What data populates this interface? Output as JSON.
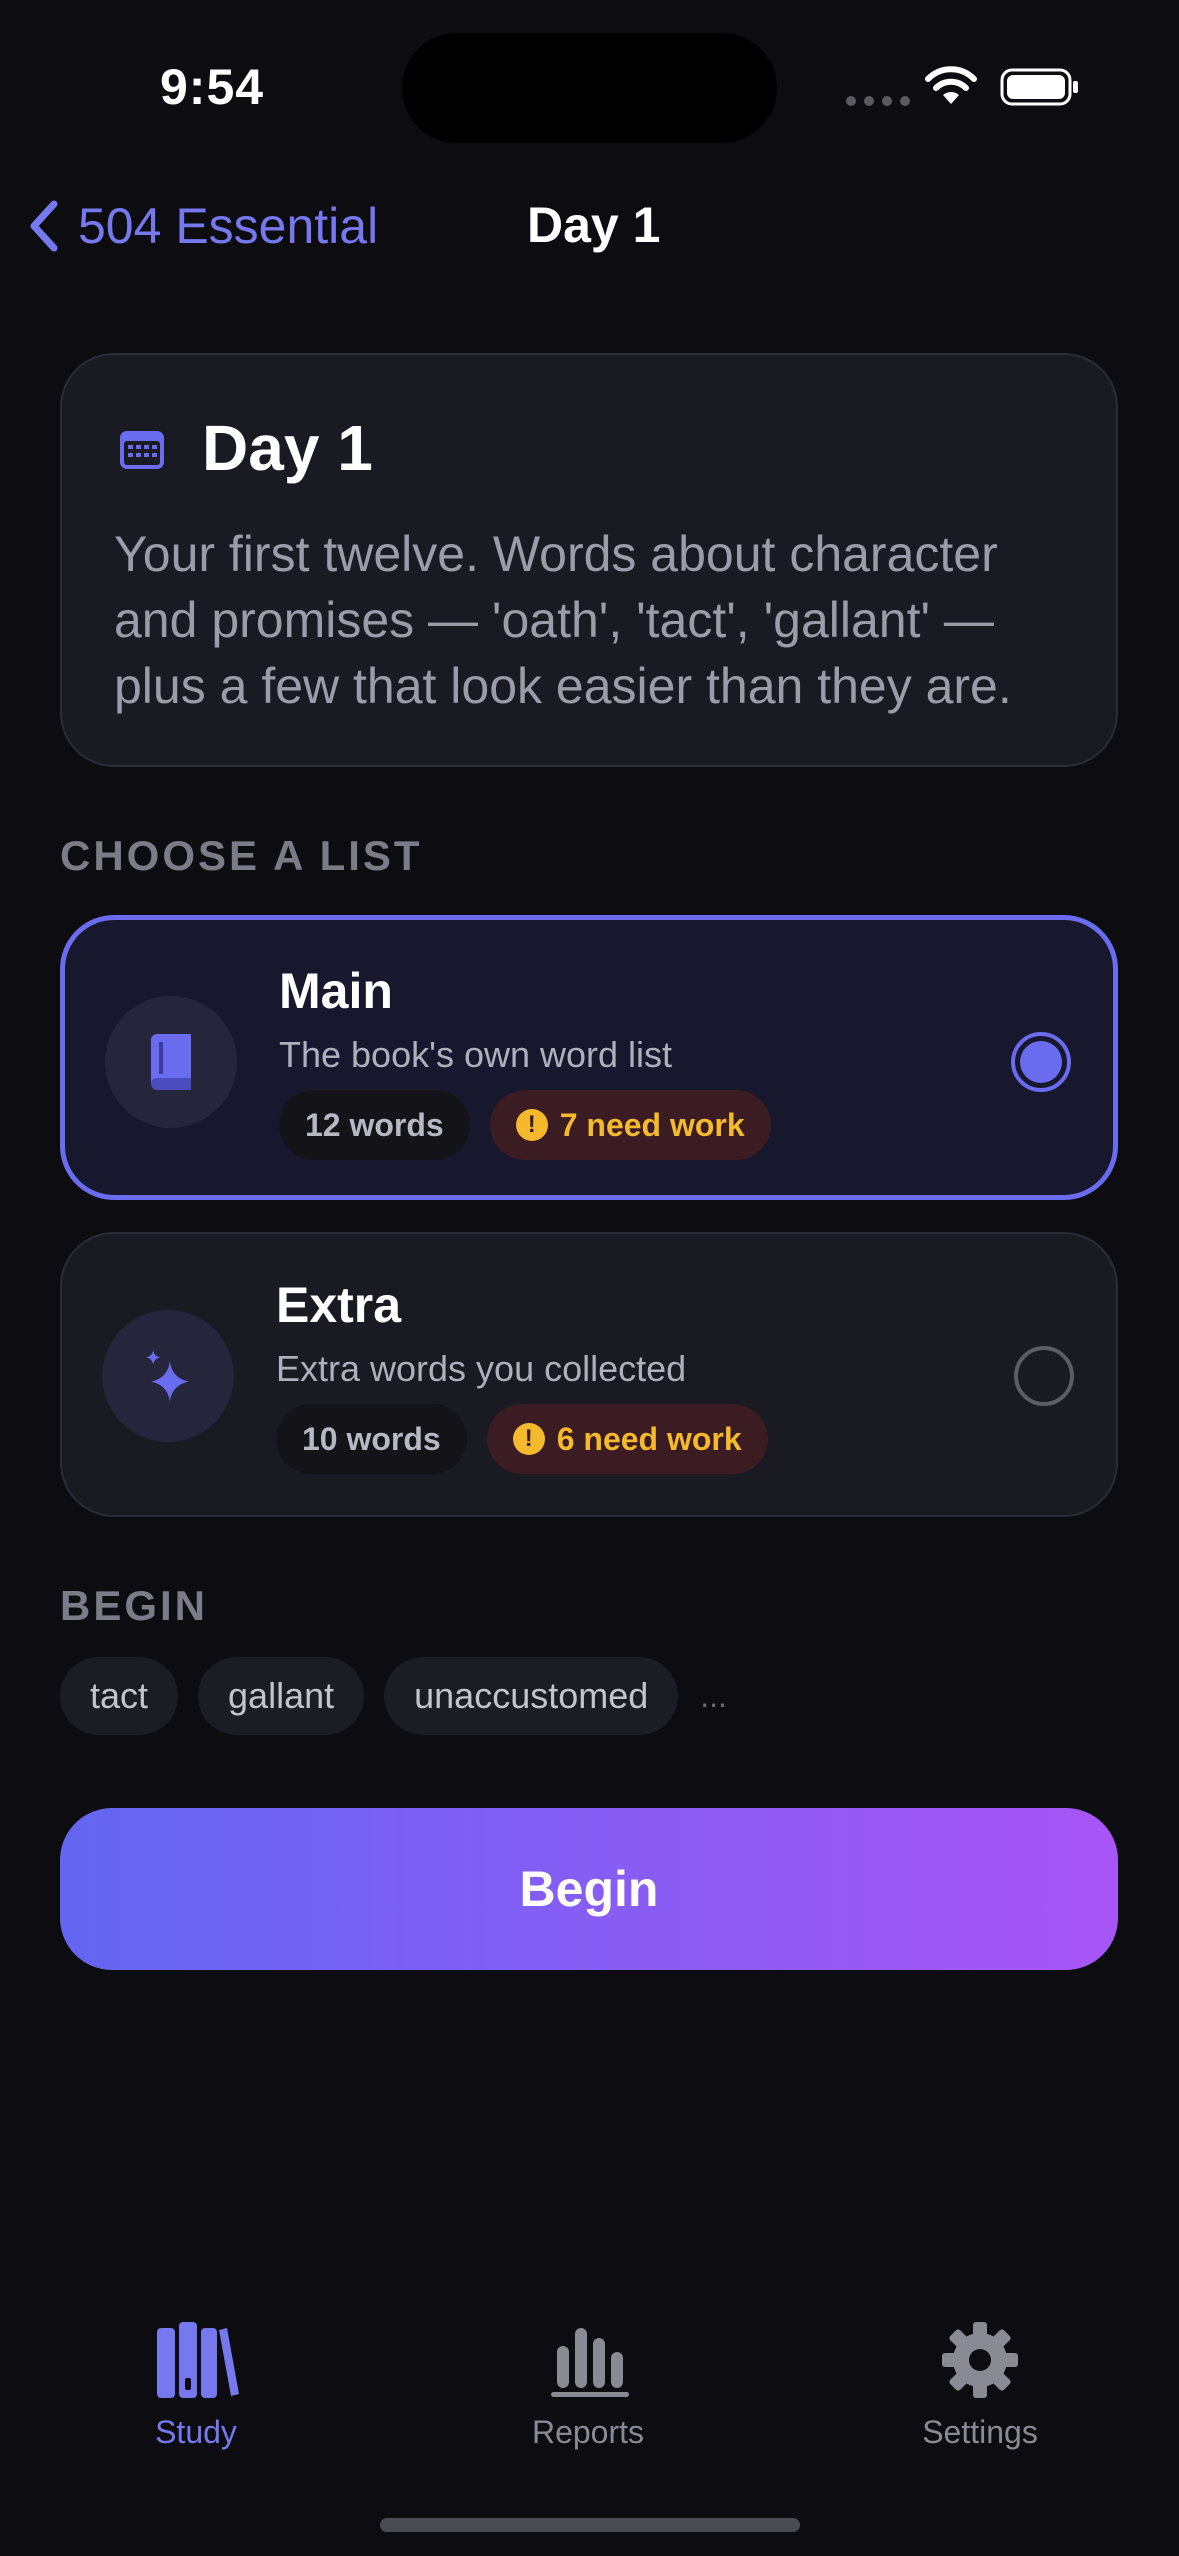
{
  "status": {
    "time": "9:54"
  },
  "nav": {
    "back_label": "504 Essential",
    "title": "Day 1"
  },
  "day_card": {
    "icon": "calendar-icon",
    "heading": "Day 1",
    "description": "Your first twelve. Words about character and promises — 'oath', 'tact', 'gallant' — plus a few that look easier than they are."
  },
  "choose_label": "CHOOSE A LIST",
  "lists": [
    {
      "icon": "book-icon",
      "title": "Main",
      "subtitle": "The book's own word list",
      "count": "12 words",
      "need_work": "7 need work",
      "selected": true
    },
    {
      "icon": "sparkles-icon",
      "title": "Extra",
      "subtitle": "Extra words you collected",
      "count": "10 words",
      "need_work": "6 need work",
      "selected": false
    }
  ],
  "begin_label": "BEGIN",
  "preview_words": [
    "tact",
    "gallant",
    "unaccustomed"
  ],
  "preview_more": "...",
  "begin_button": "Begin",
  "tabs": [
    {
      "label": "Study",
      "icon": "books-icon",
      "active": true
    },
    {
      "label": "Reports",
      "icon": "bar-chart-icon",
      "active": false
    },
    {
      "label": "Settings",
      "icon": "gear-icon",
      "active": false
    }
  ],
  "colors": {
    "accent": "#6a6cf0",
    "gradient_start": "#6366f1",
    "gradient_end": "#a855f7",
    "warning": "#f5b92e",
    "background": "#0c0c11"
  }
}
